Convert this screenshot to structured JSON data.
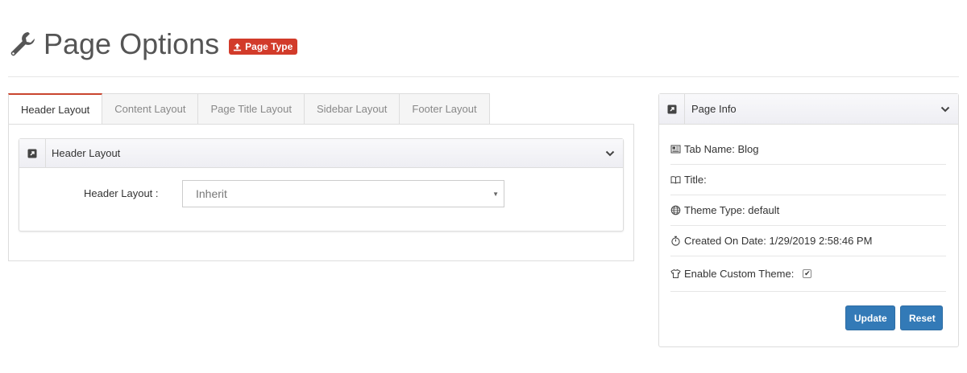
{
  "header": {
    "title": "Page Options",
    "badge": "Page Type",
    "icon": "wrench-icon",
    "badge_color": "#d23b2a"
  },
  "tabs": [
    {
      "label": "Header Layout",
      "active": true
    },
    {
      "label": "Content Layout",
      "active": false
    },
    {
      "label": "Page Title Layout",
      "active": false
    },
    {
      "label": "Sidebar Layout",
      "active": false
    },
    {
      "label": "Footer Layout",
      "active": false
    }
  ],
  "layout_panel": {
    "title": "Header Layout",
    "field_label": "Header Layout :",
    "select_value": "Inherit"
  },
  "info_panel": {
    "title": "Page Info",
    "rows": [
      {
        "label": "Tab Name: Blog",
        "icon": "newspaper-icon"
      },
      {
        "label": "Title:",
        "icon": "book-icon"
      },
      {
        "label": "Theme Type: default",
        "icon": "globe-icon"
      },
      {
        "label": "Created On Date: 1/29/2019 2:58:46 PM",
        "icon": "stopwatch-icon"
      },
      {
        "label": "Enable Custom Theme:",
        "icon": "tshirt-icon",
        "checked": true
      }
    ],
    "check_mark": "✔",
    "update_label": "Update",
    "reset_label": "Reset"
  },
  "colors": {
    "accent_tab": "#c9452e",
    "button": "#337ab7"
  }
}
